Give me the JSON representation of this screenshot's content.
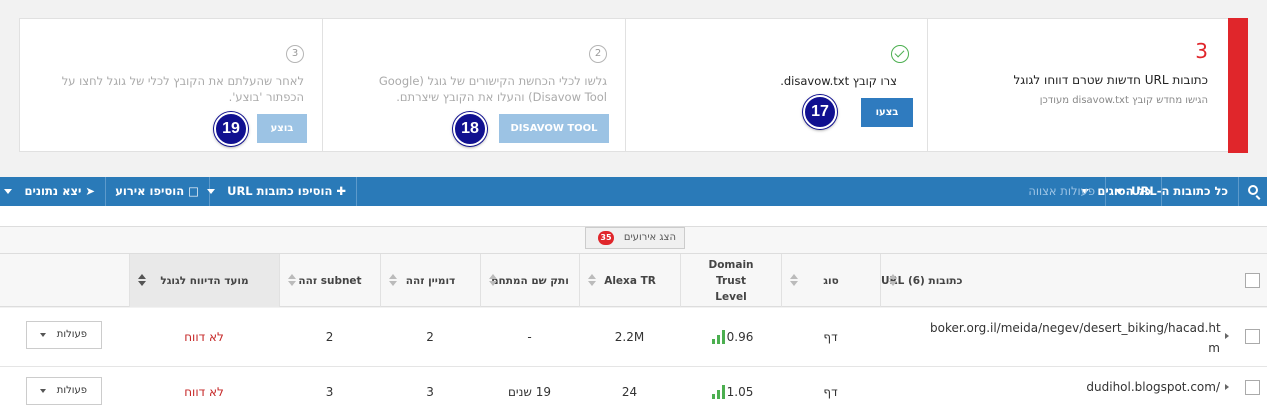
{
  "steps": {
    "count": "3",
    "title": "כתובות URL חדשות שטרם דווחו לגוגל",
    "subtitle": "הגישו מחדש קובץ disavow.txt מעודכן",
    "step1": {
      "text": "צרו קובץ disavow.txt.",
      "button": "בצעו",
      "badge": "17"
    },
    "step2": {
      "number": "2",
      "text_line1": "גלשו לכלי הכחשת הקישורים של גוגל (Google",
      "text_line2": "Disavow Tool) והעלו את הקובץ שיצרתם.",
      "button": "DISAVOW TOOL",
      "badge": "18"
    },
    "step3": {
      "number": "3",
      "text_line1": "לאחר שהעלתם את הקובץ לכלי של גוגל לחצו על",
      "text_line2": "הכפתור 'בוצע'.",
      "button": "בוצע",
      "badge": "19"
    }
  },
  "toolbar": {
    "filter_urls": "כל כתובות ה-URL",
    "filter_types": "כל הסוגים",
    "bulk_actions": "פעולות אצווה",
    "add_urls": "הוסיפו כתובות URL",
    "add_event": "הוסיפו אירוע",
    "export": "יצא נתונים"
  },
  "events": {
    "label": "הצג אירועים",
    "count": "35"
  },
  "table": {
    "headers": {
      "urls": "כתובות URL (6)",
      "type": "סוג",
      "domain_trust": "Domain Trust Level",
      "alexa": "Alexa TR",
      "domain_age": "ותק שם המתחם",
      "same_domain": "דומיין זהה",
      "same_subnet": "subnet זהה",
      "report_date": "מועד הדיווח לגוגל"
    },
    "rows": [
      {
        "url_line1": "boker.org.il/meida/negev/desert_biking/hacad.ht",
        "url_line2": "m",
        "type": "דף",
        "trust": "0.96",
        "alexa": "2.2M",
        "age": "-",
        "same_domain": "2",
        "same_subnet": "2",
        "report": "לא דווח",
        "action": "פעולות"
      },
      {
        "url_line1": "dudihol.blogspot.com/",
        "url_line2": "",
        "type": "דף",
        "trust": "1.05",
        "alexa": "24",
        "age": "19 שנים",
        "same_domain": "3",
        "same_subnet": "3",
        "report": "לא דווח",
        "action": "פעולות"
      }
    ]
  }
}
